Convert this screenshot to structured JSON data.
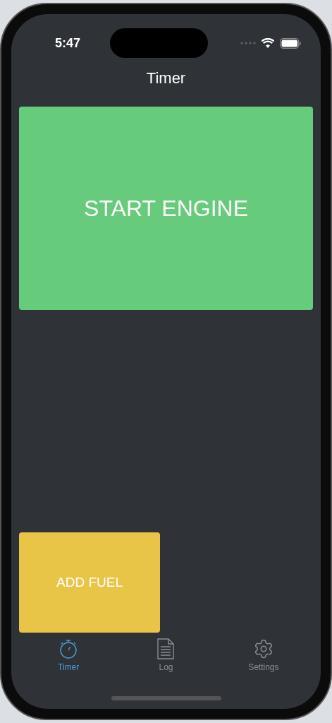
{
  "status_bar": {
    "time": "5:47"
  },
  "title": "Timer",
  "actions": [
    {
      "label": "START ENGINE",
      "color": "#66cb7b",
      "kind": "large"
    },
    {
      "label": "ADD FUEL",
      "color": "#e8c547",
      "kind": "small"
    }
  ],
  "tabs": [
    {
      "label": "Timer",
      "selected": true
    },
    {
      "label": "Log",
      "selected": false
    },
    {
      "label": "Settings",
      "selected": false
    }
  ]
}
